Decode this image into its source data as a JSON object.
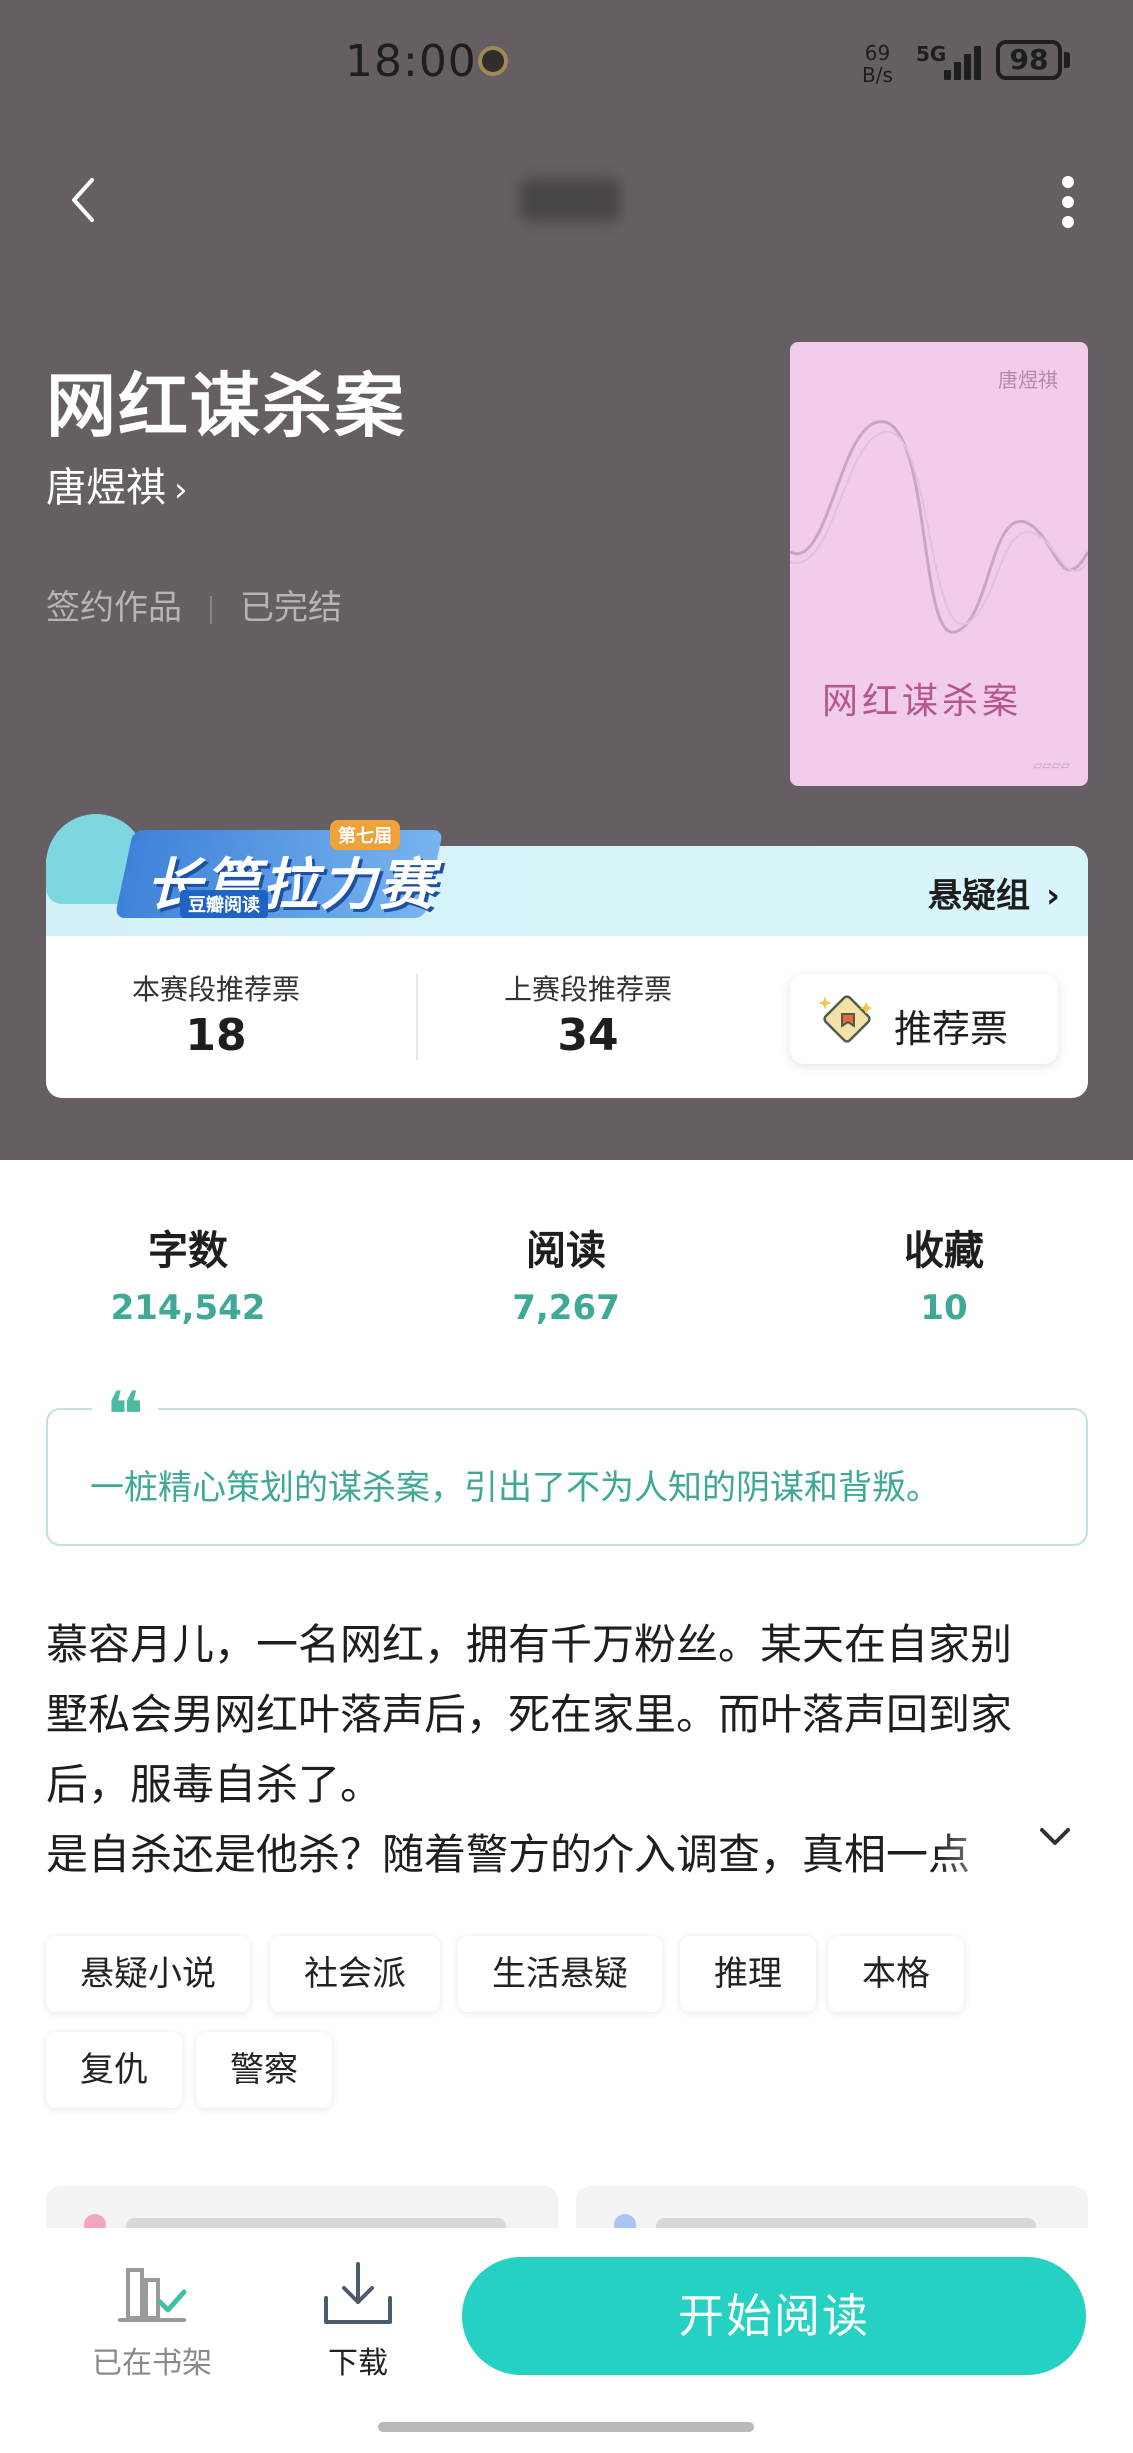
{
  "status_bar": {
    "time": "18:00",
    "net_speed_value": "69",
    "net_speed_unit": "B/s",
    "network_type": "5G",
    "battery": "98"
  },
  "book": {
    "title": "网红谋杀案",
    "author": "唐煜祺",
    "tag_signed": "签约作品",
    "tag_status": "已完结"
  },
  "cover": {
    "author": "唐煜祺",
    "title": "网红谋杀案",
    "background": "#f2cdeb"
  },
  "contest": {
    "logo_text": "长篇拉力赛",
    "logo_badge": "第七届",
    "logo_sub": "豆瓣阅读",
    "group_label": "悬疑组",
    "current_votes_label": "本赛段推荐票",
    "current_votes": "18",
    "previous_votes_label": "上赛段推荐票",
    "previous_votes": "34",
    "vote_button_label": "推荐票"
  },
  "stats": [
    {
      "label": "字数",
      "value": "214,542"
    },
    {
      "label": "阅读",
      "value": "7,267"
    },
    {
      "label": "收藏",
      "value": "10"
    }
  ],
  "quote": {
    "mark": "❝",
    "text": "一桩精心策划的谋杀案，引出了不为人知的阴谋和背叛。"
  },
  "synopsis": {
    "line1": "慕容月儿，一名网红，拥有千万粉丝。某天在自家别",
    "line2": "墅私会男网红叶落声后，死在家里。而叶落声回到家",
    "line3": "后，服毒自杀了。",
    "line4": "是自杀还是他杀？随着警方的介入调查，真相一点"
  },
  "tags": [
    "悬疑小说",
    "社会派",
    "生活悬疑",
    "推理",
    "本格",
    "复仇",
    "警察"
  ],
  "bottom_bar": {
    "bookshelf_label": "已在书架",
    "download_label": "下载",
    "start_reading_label": "开始阅读"
  },
  "colors": {
    "hero_background": "#655e62",
    "accent_teal": "#3fa896",
    "primary_button": "#25d1c2"
  }
}
